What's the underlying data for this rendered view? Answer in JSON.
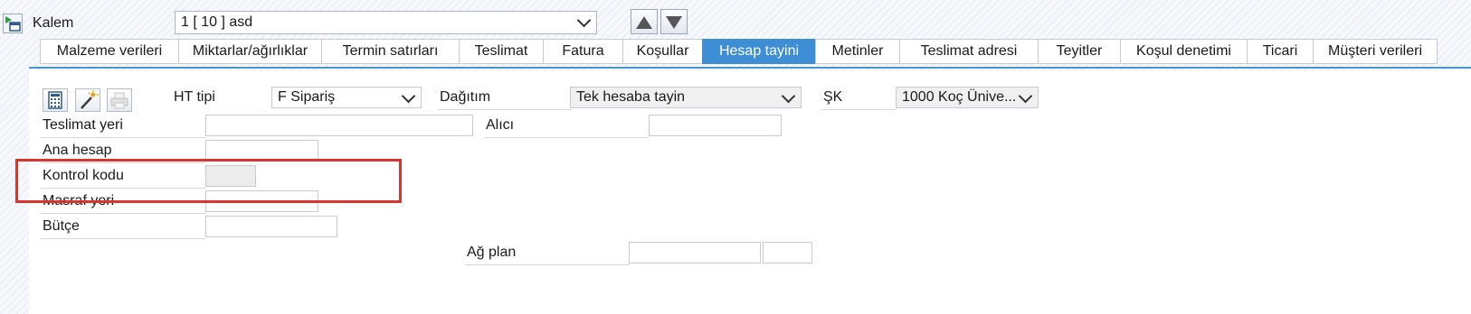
{
  "header": {
    "item_label": "Kalem",
    "item_value": "1 [ 10 ] asd"
  },
  "tabs": [
    {
      "label": "Malzeme verileri"
    },
    {
      "label": "Miktarlar/ağırlıklar"
    },
    {
      "label": "Termin satırları"
    },
    {
      "label": "Teslimat"
    },
    {
      "label": "Fatura"
    },
    {
      "label": "Koşullar"
    },
    {
      "label": "Hesap tayini"
    },
    {
      "label": "Metinler"
    },
    {
      "label": "Teslimat adresi"
    },
    {
      "label": "Teyitler"
    },
    {
      "label": "Koşul denetimi"
    },
    {
      "label": "Ticari"
    },
    {
      "label": "Müşteri verileri"
    }
  ],
  "active_tab": "Hesap tayini",
  "account": {
    "ht_tipi_label": "HT tipi",
    "ht_tipi_value": "F Sipariş",
    "dagitim_label": "Dağıtım",
    "dagitim_value": "Tek hesaba tayin",
    "sk_label": "ŞK",
    "sk_value": "1000 Koç Ünive..."
  },
  "fields": {
    "teslimat_yeri": "Teslimat yeri",
    "alici": "Alıcı",
    "ana_hesap": "Ana hesap",
    "kontrol_kodu": "Kontrol kodu",
    "masraf_yeri": "Masraf yeri",
    "butce": "Bütçe",
    "ag_plan": "Ağ plan"
  },
  "colors": {
    "accent": "#3d8ed4",
    "highlight": "#d9352f"
  },
  "icons": [
    "item-detail-icon",
    "arrow-up-icon",
    "arrow-down-icon",
    "calculator-icon",
    "magic-wand-icon",
    "printer-icon",
    "dropdown-chevron-icon"
  ]
}
